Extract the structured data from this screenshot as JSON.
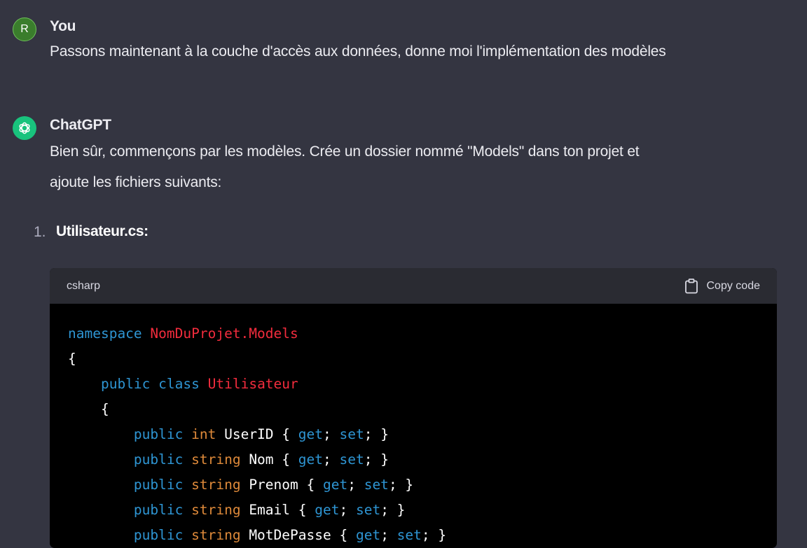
{
  "user_message": {
    "avatar_letter": "R",
    "author": "You",
    "text": "Passons maintenant à la couche d'accès aux données, donne moi l'implémentation des modèles"
  },
  "assistant_message": {
    "author": "ChatGPT",
    "text_line1": "Bien sûr, commençons par les modèles. Crée un dossier nommé \"Models\" dans ton projet et",
    "text_line2": "ajoute les fichiers suivants:",
    "list": {
      "number": "1.",
      "title": "Utilisateur.cs:"
    },
    "code_block": {
      "language": "csharp",
      "copy_label": "Copy code",
      "lines": [
        [
          {
            "t": "namespace",
            "c": "kw"
          },
          {
            "t": " ",
            "c": "pl"
          },
          {
            "t": "NomDuProjet.Models",
            "c": "ty"
          }
        ],
        [
          {
            "t": "{",
            "c": "pl"
          }
        ],
        [
          {
            "t": "    ",
            "c": "pl"
          },
          {
            "t": "public",
            "c": "kw"
          },
          {
            "t": " ",
            "c": "pl"
          },
          {
            "t": "class",
            "c": "kw"
          },
          {
            "t": " ",
            "c": "pl"
          },
          {
            "t": "Utilisateur",
            "c": "ty"
          }
        ],
        [
          {
            "t": "    {",
            "c": "pl"
          }
        ],
        [
          {
            "t": "        ",
            "c": "pl"
          },
          {
            "t": "public",
            "c": "kw"
          },
          {
            "t": " ",
            "c": "pl"
          },
          {
            "t": "int",
            "c": "pt"
          },
          {
            "t": " UserID { ",
            "c": "pl"
          },
          {
            "t": "get",
            "c": "kw"
          },
          {
            "t": "; ",
            "c": "pl"
          },
          {
            "t": "set",
            "c": "kw"
          },
          {
            "t": "; }",
            "c": "pl"
          }
        ],
        [
          {
            "t": "        ",
            "c": "pl"
          },
          {
            "t": "public",
            "c": "kw"
          },
          {
            "t": " ",
            "c": "pl"
          },
          {
            "t": "string",
            "c": "pt"
          },
          {
            "t": " Nom { ",
            "c": "pl"
          },
          {
            "t": "get",
            "c": "kw"
          },
          {
            "t": "; ",
            "c": "pl"
          },
          {
            "t": "set",
            "c": "kw"
          },
          {
            "t": "; }",
            "c": "pl"
          }
        ],
        [
          {
            "t": "        ",
            "c": "pl"
          },
          {
            "t": "public",
            "c": "kw"
          },
          {
            "t": " ",
            "c": "pl"
          },
          {
            "t": "string",
            "c": "pt"
          },
          {
            "t": " Prenom { ",
            "c": "pl"
          },
          {
            "t": "get",
            "c": "kw"
          },
          {
            "t": "; ",
            "c": "pl"
          },
          {
            "t": "set",
            "c": "kw"
          },
          {
            "t": "; }",
            "c": "pl"
          }
        ],
        [
          {
            "t": "        ",
            "c": "pl"
          },
          {
            "t": "public",
            "c": "kw"
          },
          {
            "t": " ",
            "c": "pl"
          },
          {
            "t": "string",
            "c": "pt"
          },
          {
            "t": " Email { ",
            "c": "pl"
          },
          {
            "t": "get",
            "c": "kw"
          },
          {
            "t": "; ",
            "c": "pl"
          },
          {
            "t": "set",
            "c": "kw"
          },
          {
            "t": "; }",
            "c": "pl"
          }
        ],
        [
          {
            "t": "        ",
            "c": "pl"
          },
          {
            "t": "public",
            "c": "kw"
          },
          {
            "t": " ",
            "c": "pl"
          },
          {
            "t": "string",
            "c": "pt"
          },
          {
            "t": " MotDePasse { ",
            "c": "pl"
          },
          {
            "t": "get",
            "c": "kw"
          },
          {
            "t": "; ",
            "c": "pl"
          },
          {
            "t": "set",
            "c": "kw"
          },
          {
            "t": "; }",
            "c": "pl"
          }
        ]
      ]
    }
  },
  "colors": {
    "background": "#343541",
    "code_background": "#000000",
    "code_header": "#2a2b32",
    "keyword": "#2e95d3",
    "type_name": "#f22c3d",
    "primitive": "#df8a3a",
    "gpt_avatar": "#19c37d",
    "user_avatar": "#3a7d2c"
  },
  "icons": {
    "gpt_avatar": "openai-logo-icon",
    "copy": "clipboard-icon"
  }
}
